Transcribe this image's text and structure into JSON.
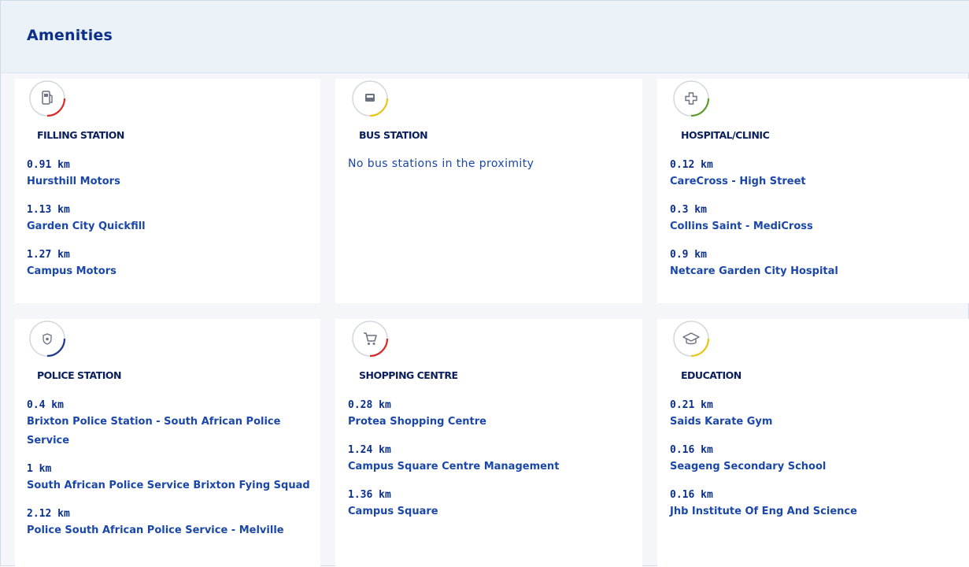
{
  "panel": {
    "title": "Amenities"
  },
  "colors": {
    "title": "#0b2f8a",
    "distance": "#0b2f8a",
    "name": "#1a47a8",
    "header_bg": "#eaf1f7",
    "ring_grey": "#d4d8de",
    "red": "#d62b2b",
    "yellow": "#e6c619",
    "green": "#5c9a29",
    "navy": "#1f3a8a"
  },
  "categories": [
    {
      "label": "FILLING STATION",
      "icon": "fuel-pump-icon",
      "accent": "#d62b2b",
      "empty_text": "",
      "items": [
        {
          "distance": "0.91 km",
          "name": "Hursthill Motors"
        },
        {
          "distance": "1.13 km",
          "name": "Garden City Quickfill"
        },
        {
          "distance": "1.27 km",
          "name": "Campus Motors"
        }
      ]
    },
    {
      "label": "BUS STATION",
      "icon": "bus-icon",
      "accent": "#e6c619",
      "empty_text": "No bus stations in the proximity",
      "items": []
    },
    {
      "label": "HOSPITAL/CLINIC",
      "icon": "medical-cross-icon",
      "accent": "#5c9a29",
      "empty_text": "",
      "items": [
        {
          "distance": "0.12 km",
          "name": "CareCross - High Street"
        },
        {
          "distance": "0.3 km",
          "name": "Collins Saint - MediCross"
        },
        {
          "distance": "0.9 km",
          "name": "Netcare Garden City Hospital"
        }
      ]
    },
    {
      "label": "POLICE STATION",
      "icon": "police-badge-icon",
      "accent": "#1f3a8a",
      "empty_text": "",
      "items": [
        {
          "distance": "0.4 km",
          "name": "Brixton Police Station - South African Police Service"
        },
        {
          "distance": "1 km",
          "name": "South African Police Service Brixton Fying Squad"
        },
        {
          "distance": "2.12 km",
          "name": "Police South African Police Service - Melville"
        }
      ]
    },
    {
      "label": "SHOPPING CENTRE",
      "icon": "shopping-cart-icon",
      "accent": "#d62b2b",
      "empty_text": "",
      "items": [
        {
          "distance": "0.28 km",
          "name": "Protea Shopping Centre"
        },
        {
          "distance": "1.24 km",
          "name": "Campus Square Centre Management"
        },
        {
          "distance": "1.36 km",
          "name": "Campus Square"
        }
      ]
    },
    {
      "label": "EDUCATION",
      "icon": "graduation-cap-icon",
      "accent": "#e6c619",
      "empty_text": "",
      "items": [
        {
          "distance": "0.21 km",
          "name": "Saids Karate Gym"
        },
        {
          "distance": "0.16 km",
          "name": "Seageng Secondary School"
        },
        {
          "distance": "0.16 km",
          "name": "Jhb Institute Of Eng And Science"
        }
      ]
    }
  ]
}
